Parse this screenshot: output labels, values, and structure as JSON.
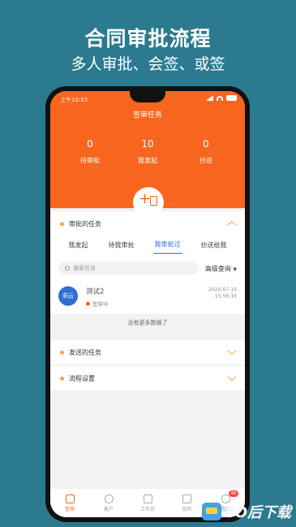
{
  "promo": {
    "title": "合同审批流程",
    "subtitle": "多人审批、会签、或签"
  },
  "status_bar": {
    "time": "上午10:55"
  },
  "header": {
    "title": "签审任务",
    "stats": [
      {
        "value": "0",
        "label": "待审批"
      },
      {
        "value": "10",
        "label": "我发起"
      },
      {
        "value": "0",
        "label": "抄送"
      }
    ]
  },
  "approval_section": {
    "title": "审批的任务",
    "tabs": [
      "我发起",
      "待我审批",
      "我审批过",
      "抄送给我"
    ],
    "active_tab": "我审批过",
    "search_placeholder": "搜索任务",
    "advanced_label": "高级查询",
    "tasks": [
      {
        "avatar_text": "莉云",
        "title": "测试2",
        "status": "签审中",
        "date": "2020-07-15",
        "time": "15:56:16"
      }
    ],
    "no_more_text": "没有更多数据了"
  },
  "sent_section": {
    "title": "发送的任务"
  },
  "flow_section": {
    "title": "流程设置"
  },
  "bottom_nav": {
    "items": [
      {
        "label": "签审",
        "icon": "sign-icon"
      },
      {
        "label": "客户",
        "icon": "customers-icon"
      },
      {
        "label": "工作台",
        "icon": "workbench-icon"
      },
      {
        "label": "合同",
        "icon": "contract-icon"
      },
      {
        "label": "我的",
        "icon": "profile-icon",
        "badge": "48"
      }
    ]
  },
  "watermark": {
    "text": "8O后下载"
  },
  "colors": {
    "accent": "#f7651e",
    "active_tab": "#2f6fd6",
    "background": "#2b7a8f"
  }
}
